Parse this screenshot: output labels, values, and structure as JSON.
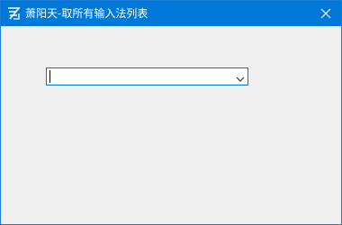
{
  "window": {
    "title": "萧阳天-取所有输入法列表",
    "close_icon": "close-icon",
    "app_icon": "app-logo-icon"
  },
  "combo": {
    "value": "",
    "arrow_icon": "chevron-down-icon"
  },
  "colors": {
    "titlebar": "#0078d7",
    "client_bg": "#f0f0f0",
    "combo_border": "#0078d7"
  }
}
